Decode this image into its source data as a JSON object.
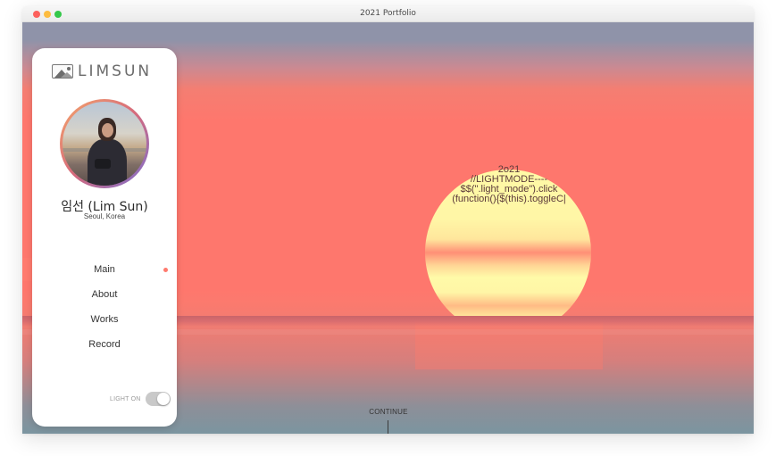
{
  "window": {
    "title": "2021 Portfolio"
  },
  "sidebar": {
    "logo_text": "LIMSUN",
    "profile": {
      "name": "임선 (Lim Sun)",
      "location": "Seoul, Korea"
    },
    "nav": [
      {
        "label": "Main",
        "active": true
      },
      {
        "label": "About",
        "active": false
      },
      {
        "label": "Works",
        "active": false
      },
      {
        "label": "Record",
        "active": false
      }
    ],
    "light_toggle": {
      "label": "LIGHT ON",
      "on": true
    }
  },
  "main": {
    "code_lines": [
      "2o21",
      "//LIGHTMODE----",
      "$$(\".light_mode\").click",
      "(function(){$(this).toggleC|"
    ],
    "continue_label": "CONTINUE"
  },
  "colors": {
    "accent": "#ff7a6e",
    "sky": "#fe776d",
    "sun": "#fff6a6"
  }
}
